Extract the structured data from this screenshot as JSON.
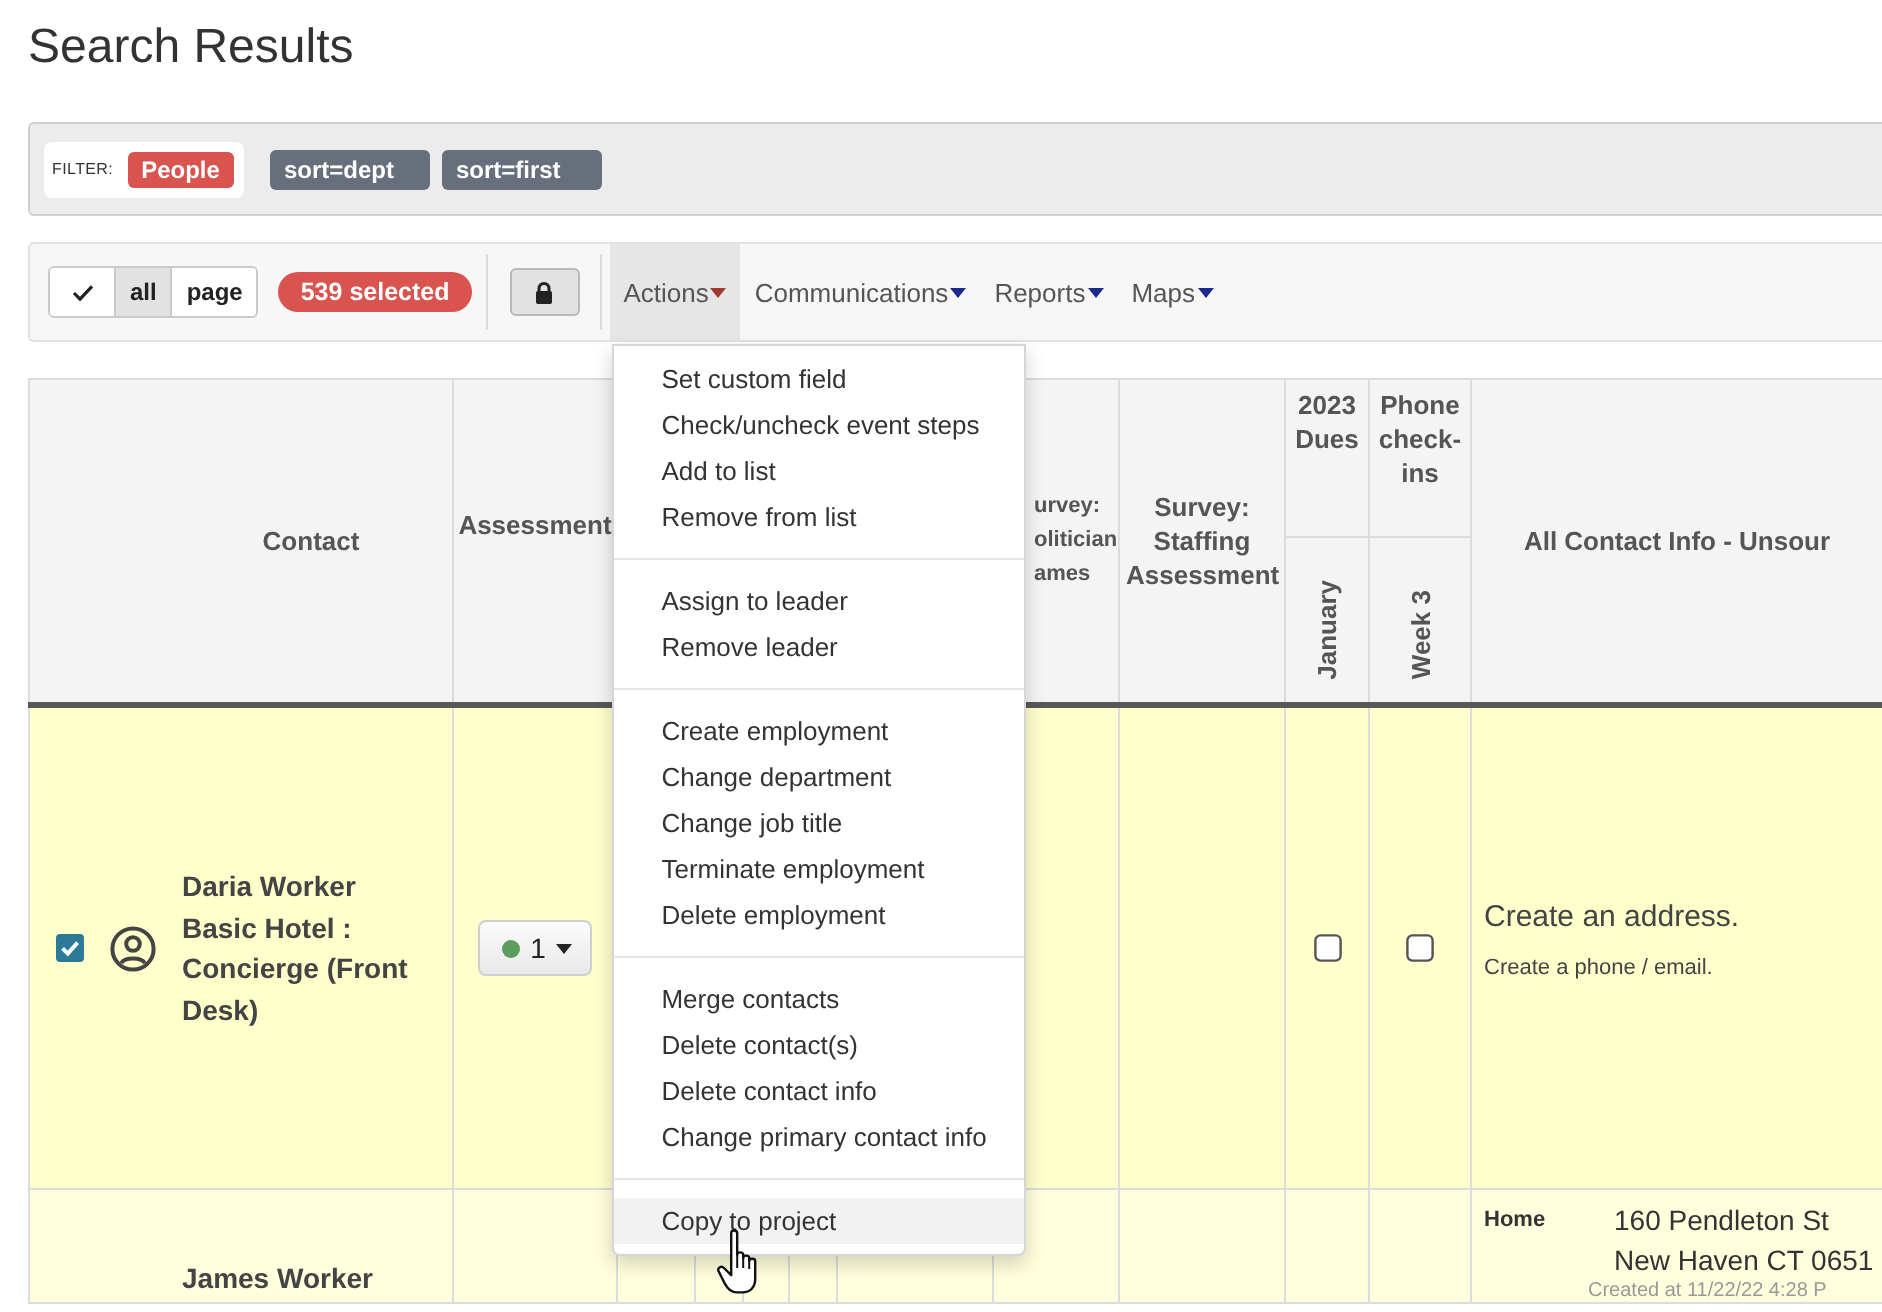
{
  "page": {
    "title": "Search Results"
  },
  "filter": {
    "label": "FILTER:",
    "tag": "People",
    "sorts": [
      "sort=dept",
      "sort=first"
    ]
  },
  "toolbar": {
    "select_buttons": [
      {
        "kind": "check",
        "selected": false
      },
      {
        "kind": "text",
        "label": "all",
        "selected": true
      },
      {
        "kind": "text",
        "label": "page",
        "selected": false
      }
    ],
    "selected_count": "539 selected",
    "locked": true,
    "menus": [
      {
        "label": "Actions",
        "open": true
      },
      {
        "label": "Communications",
        "open": false
      },
      {
        "label": "Reports",
        "open": false
      },
      {
        "label": "Maps",
        "open": false
      }
    ]
  },
  "actions_menu": {
    "groups": [
      {
        "items": [
          {
            "label": "Set custom field",
            "highlighted": false
          },
          {
            "label": "Check/uncheck event steps",
            "highlighted": false
          },
          {
            "label": "Add to list",
            "highlighted": false
          },
          {
            "label": "Remove from list",
            "highlighted": false
          }
        ]
      },
      {
        "items": [
          {
            "label": "Assign to leader",
            "highlighted": false
          },
          {
            "label": "Remove leader",
            "highlighted": false
          }
        ]
      },
      {
        "items": [
          {
            "label": "Create employment",
            "highlighted": false
          },
          {
            "label": "Change department",
            "highlighted": false
          },
          {
            "label": "Change job title",
            "highlighted": false
          },
          {
            "label": "Terminate employment",
            "highlighted": false
          },
          {
            "label": "Delete employment",
            "highlighted": false
          }
        ]
      },
      {
        "items": [
          {
            "label": "Merge contacts",
            "highlighted": false
          },
          {
            "label": "Delete contact(s)",
            "highlighted": false
          },
          {
            "label": "Delete contact info",
            "highlighted": false
          },
          {
            "label": "Change primary contact info",
            "highlighted": false
          }
        ]
      },
      {
        "items": [
          {
            "label": "Copy to project",
            "highlighted": true
          }
        ]
      }
    ]
  },
  "table": {
    "columns": [
      {
        "kind": "contact",
        "label": "Contact"
      },
      {
        "kind": "assessment",
        "label": "Assessment"
      },
      {
        "kind": "blank"
      },
      {
        "kind": "blank"
      },
      {
        "kind": "blank"
      },
      {
        "kind": "blank"
      },
      {
        "kind": "blank"
      },
      {
        "kind": "partial",
        "lines": [
          "urvey:",
          "olitician",
          "ames"
        ]
      },
      {
        "kind": "text",
        "label": "Survey: Staffing Assessment"
      },
      {
        "kind": "checkbox_group",
        "label": "2023 Dues",
        "sub_label": "January"
      },
      {
        "kind": "checkbox_group",
        "label": "Phone check-ins",
        "sub_label": "Week 3"
      },
      {
        "kind": "contact_info",
        "label": "All Contact Info - Unsour"
      }
    ],
    "rows": [
      {
        "checked": true,
        "name": "Daria Worker",
        "employment": "Basic Hotel : Concierge (Front Desk)",
        "assessment": {
          "value": "1",
          "color": "#5c9c5c"
        },
        "checkboxes": [
          {
            "checked": false
          },
          {
            "checked": false
          }
        ],
        "contact_info": {
          "kind": "prompt",
          "address": "Create an address.",
          "phone_email": "Create a phone / email."
        }
      },
      {
        "name": "James Worker",
        "contact_info": {
          "kind": "address",
          "label": "Home",
          "lines": [
            "160 Pendleton St",
            "New Haven CT 0651"
          ],
          "created": "Created at 11/22/22 4:28 P"
        }
      }
    ]
  }
}
